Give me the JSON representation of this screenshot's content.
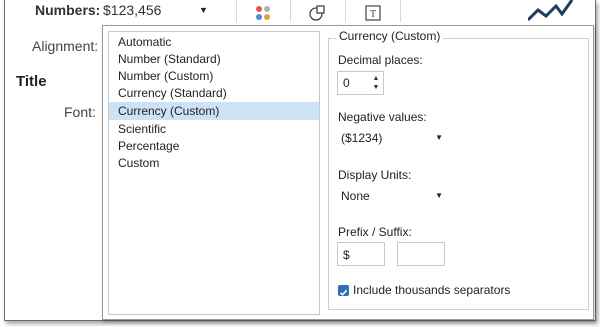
{
  "left_pane": {
    "numbers_label": "Numbers:",
    "numbers_value": "$123,456",
    "alignment_label": "Alignment:",
    "title_label": "Title",
    "font_label": "Font:"
  },
  "toolbar": {
    "icons": [
      "color-dots-icon",
      "shapes-icon",
      "text-icon"
    ],
    "accent_color": "#1f3d5c"
  },
  "format_list": {
    "items": [
      "Automatic",
      "Number (Standard)",
      "Number (Custom)",
      "Currency (Standard)",
      "Currency (Custom)",
      "Scientific",
      "Percentage",
      "Custom"
    ],
    "selected": "Currency (Custom)",
    "selected_color": "#cde3f5"
  },
  "settings": {
    "title": "Currency (Custom)",
    "decimal_places_label": "Decimal places:",
    "decimal_places_value": "0",
    "negative_values_label": "Negative values:",
    "negative_values_selected": "($1234)",
    "display_units_label": "Display Units:",
    "display_units_selected": "None",
    "prefix_suffix_label": "Prefix / Suffix:",
    "prefix_value": "$",
    "suffix_value": "",
    "thousands_label": "Include thousands separators",
    "thousands_checked": true,
    "checkbox_color": "#2d6fb8"
  }
}
